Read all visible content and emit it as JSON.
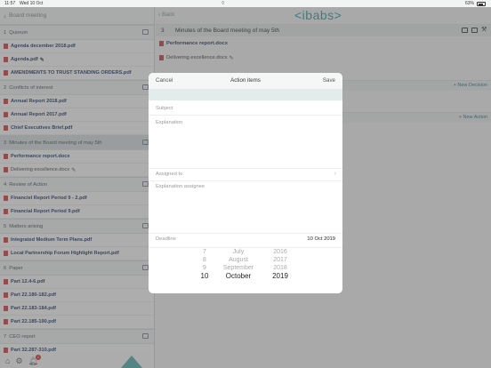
{
  "status": {
    "time": "11:57",
    "date": "Wed 10 Oct",
    "battery": "63%"
  },
  "sidebar": {
    "back_label": "Board meeting",
    "sections": [
      {
        "num": "1",
        "title": "Quorum",
        "docs": [
          {
            "name": "Agenda december 2018.pdf",
            "bold": true,
            "edit": false
          },
          {
            "name": "Agenda.pdf",
            "bold": true,
            "edit": true
          },
          {
            "name": "AMENDMENTS TO TRUST STANDING ORDERS.pdf",
            "bold": true,
            "edit": false
          }
        ]
      },
      {
        "num": "2",
        "title": "Conflicts of interest",
        "docs": [
          {
            "name": "Annual Report 2018.pdf",
            "bold": true,
            "edit": false
          },
          {
            "name": "Annual Report 2017.pdf",
            "bold": true,
            "edit": false
          },
          {
            "name": "Chief Executives Brief.pdf",
            "bold": true,
            "edit": false
          }
        ]
      },
      {
        "num": "3",
        "title": "Minutes of the Board meeting of may 5th",
        "active": true,
        "docs": [
          {
            "name": "Performance report.docx",
            "bold": true,
            "edit": false
          },
          {
            "name": "Delivering excellence.docx",
            "bold": false,
            "edit": true
          }
        ]
      },
      {
        "num": "4",
        "title": "Review of Action",
        "docs": [
          {
            "name": "Financiel Report Period 9 - 2.pdf",
            "bold": true,
            "edit": false
          },
          {
            "name": "Financial Report Period 9.pdf",
            "bold": true,
            "edit": false
          }
        ]
      },
      {
        "num": "5",
        "title": "Matters arising",
        "docs": [
          {
            "name": "Integrated Medium Term Plans.pdf",
            "bold": true,
            "edit": false
          },
          {
            "name": "Local Partnership Forum Highlight Report.pdf",
            "bold": true,
            "edit": false
          }
        ]
      },
      {
        "num": "6",
        "title": "Paper",
        "docs": [
          {
            "name": "Part 12.4-6.pdf",
            "bold": true,
            "edit": false
          },
          {
            "name": "Part 22.180-182.pdf",
            "bold": true,
            "edit": false
          },
          {
            "name": "Part 22.183-184.pdf",
            "bold": true,
            "edit": false
          },
          {
            "name": "Part 22.185-190.pdf",
            "bold": true,
            "edit": false
          }
        ]
      },
      {
        "num": "7",
        "title": "CEO report",
        "docs": [
          {
            "name": "Part 32.287-310.pdf",
            "bold": true,
            "edit": false
          }
        ]
      }
    ],
    "badge": "1"
  },
  "main": {
    "back_label": "Back",
    "logo": "<ibabs>",
    "agenda_num": "3",
    "agenda_title": "Minutes of the Board meeting of may 5th",
    "docs": [
      {
        "name": "Performance report.docx",
        "bold": true
      },
      {
        "name": "Delivering excellence.docx",
        "bold": false
      }
    ],
    "new_decision": "+ New Decision",
    "new_action": "+ New Action"
  },
  "modal": {
    "cancel": "Cancel",
    "title": "Action items",
    "save": "Save",
    "subject_placeholder": "Subject",
    "explanation_placeholder": "Explanation",
    "assigned_to": "Assigned to",
    "explanation_assignee": "Explanation assignee",
    "deadline_label": "Deadline",
    "deadline_value": "10 Oct 2019",
    "picker": {
      "days": [
        "7",
        "8",
        "9",
        "10"
      ],
      "months": [
        "July",
        "August",
        "September",
        "October"
      ],
      "years": [
        "2016",
        "2017",
        "2018",
        "2019"
      ],
      "selected_index": 3
    }
  }
}
